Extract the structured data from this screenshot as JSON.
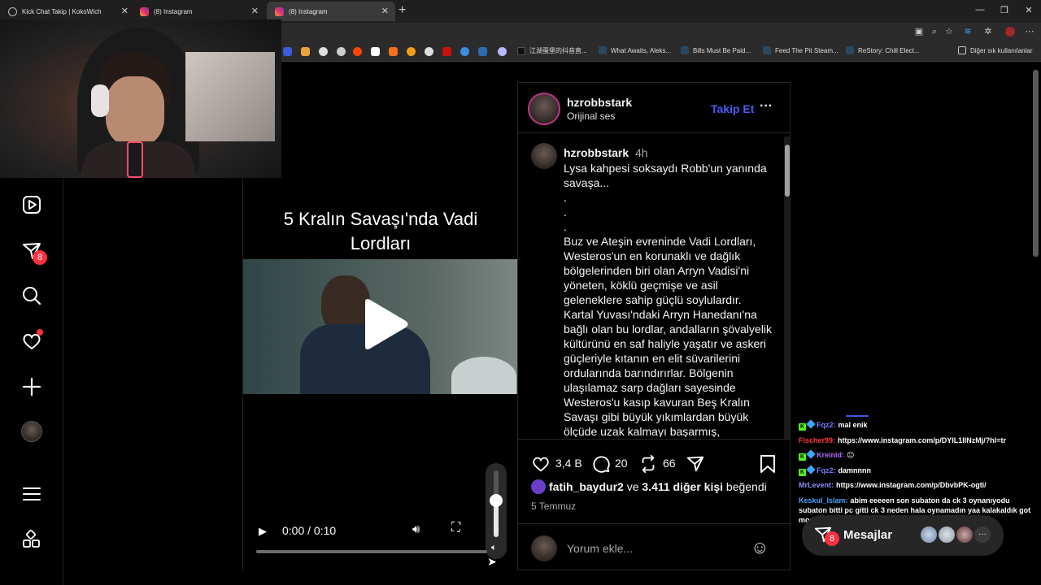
{
  "browser": {
    "tabs": [
      {
        "label": "Kick Chat Takip | KokoWich",
        "icon": "globe-icon"
      },
      {
        "label": "(8) Instagram",
        "icon": "instagram-icon"
      },
      {
        "label": "(8) Instagram",
        "icon": "instagram-icon"
      }
    ],
    "new_tab": "+",
    "window_controls": {
      "minimize": "—",
      "restore": "❐",
      "close": "✕"
    },
    "bookmarks": [
      "江湖蛋堡的抖音直...",
      "What Awaits, Aleks...",
      "Bills Must Be Paid...",
      "Feed The Pit Steam...",
      "ReStory: Chill Elect..."
    ],
    "other_bookmarks": "Diğer sık kullanılanlar"
  },
  "sidebar": {
    "items": [
      {
        "name": "reels-icon"
      },
      {
        "name": "messages-icon",
        "badge": "8"
      },
      {
        "name": "search-icon"
      },
      {
        "name": "notifications-icon",
        "dot": true
      },
      {
        "name": "create-icon"
      },
      {
        "name": "profile-avatar"
      },
      {
        "name": "menu-icon"
      },
      {
        "name": "apps-icon"
      }
    ]
  },
  "video": {
    "title_line1": "5 Kralın Savaşı'nda Vadi",
    "title_line2": "Lordları",
    "time": "0:00 / 0:10",
    "progress_fraction": 0.0,
    "volume_fraction": 0.55
  },
  "post": {
    "username": "hzrobbstark",
    "audio": "Orijinal ses",
    "follow_label": "Takip Et",
    "more": "···",
    "caption_user": "hzrobbstark",
    "caption_time": "4h",
    "caption": "Lysa kahpesi soksaydı Robb'un yanında savaşa...\n.\n.\n.\nBuz ve Ateşin evreninde Vadi Lordları, Westeros'un en korunaklı ve dağlık bölgelerinden biri olan Arryn Vadisi'ni yöneten, köklü geçmişe ve asil geleneklere sahip güçlü soylulardır. Kartal Yuvası'ndaki Arryn Hanedanı'na bağlı olan bu lordlar, andalların şövalyelik kültürünü en saf haliyle yaşatır ve askeri güçleriyle kıtanın en elit süvarilerini ordularında barındırırlar. Bölgenin ulaşılamaz sarp dağları sayesinde Westeros'u kasıp kavuran Beş Kralın Savaşı gibi büyük yıkımlardan büyük ölçüde uzak kalmayı başarmış,",
    "likes": "3,4 B",
    "comments": "20",
    "reposts": "66",
    "liked_by_user": "fatih_baydur2",
    "liked_by_and": "ve",
    "liked_by_others": "3.411 diğer kişi",
    "liked_by_suffix": "beğendi",
    "date": "5 Temmuz",
    "comment_placeholder": "Yorum ekle...",
    "emoji": "☺"
  },
  "chat": [
    {
      "user": "Fqz2:",
      "color": "#7b7bff",
      "badges": [
        "K",
        "D"
      ],
      "text": "mal enik"
    },
    {
      "user": "Fischer99:",
      "color": "#ff3b3b",
      "badges": [],
      "text": "https://www.instagram.com/p/DYIL1IlNzMj/?hl=tr"
    },
    {
      "user": "Kreinid:",
      "color": "#b06bff",
      "badges": [
        "K",
        "D"
      ],
      "text": "😐"
    },
    {
      "user": "Fqz2:",
      "color": "#7b7bff",
      "badges": [
        "K",
        "D"
      ],
      "text": "damnnnn"
    },
    {
      "user": "MrLevent:",
      "color": "#8c8cff",
      "badges": [],
      "text": "https://www.instagram.com/p/DbvbPK-ogti/"
    },
    {
      "user": "Keskul_Islam:",
      "color": "#4aa3ff",
      "badges": [],
      "text": "abim eeeeen son subaton da ck 3 oynanıyodu subaton bitti pc gitti ck 3 neden hala oynamadın yaa kalakaldık got modlu ck ya"
    }
  ],
  "messages_pill": {
    "label": "Mesajlar",
    "badge": "8",
    "more": "···"
  },
  "colors": {
    "accent_blue": "#4a5df9",
    "badge_red": "#ff3040",
    "kick_green": "#53fc18"
  }
}
